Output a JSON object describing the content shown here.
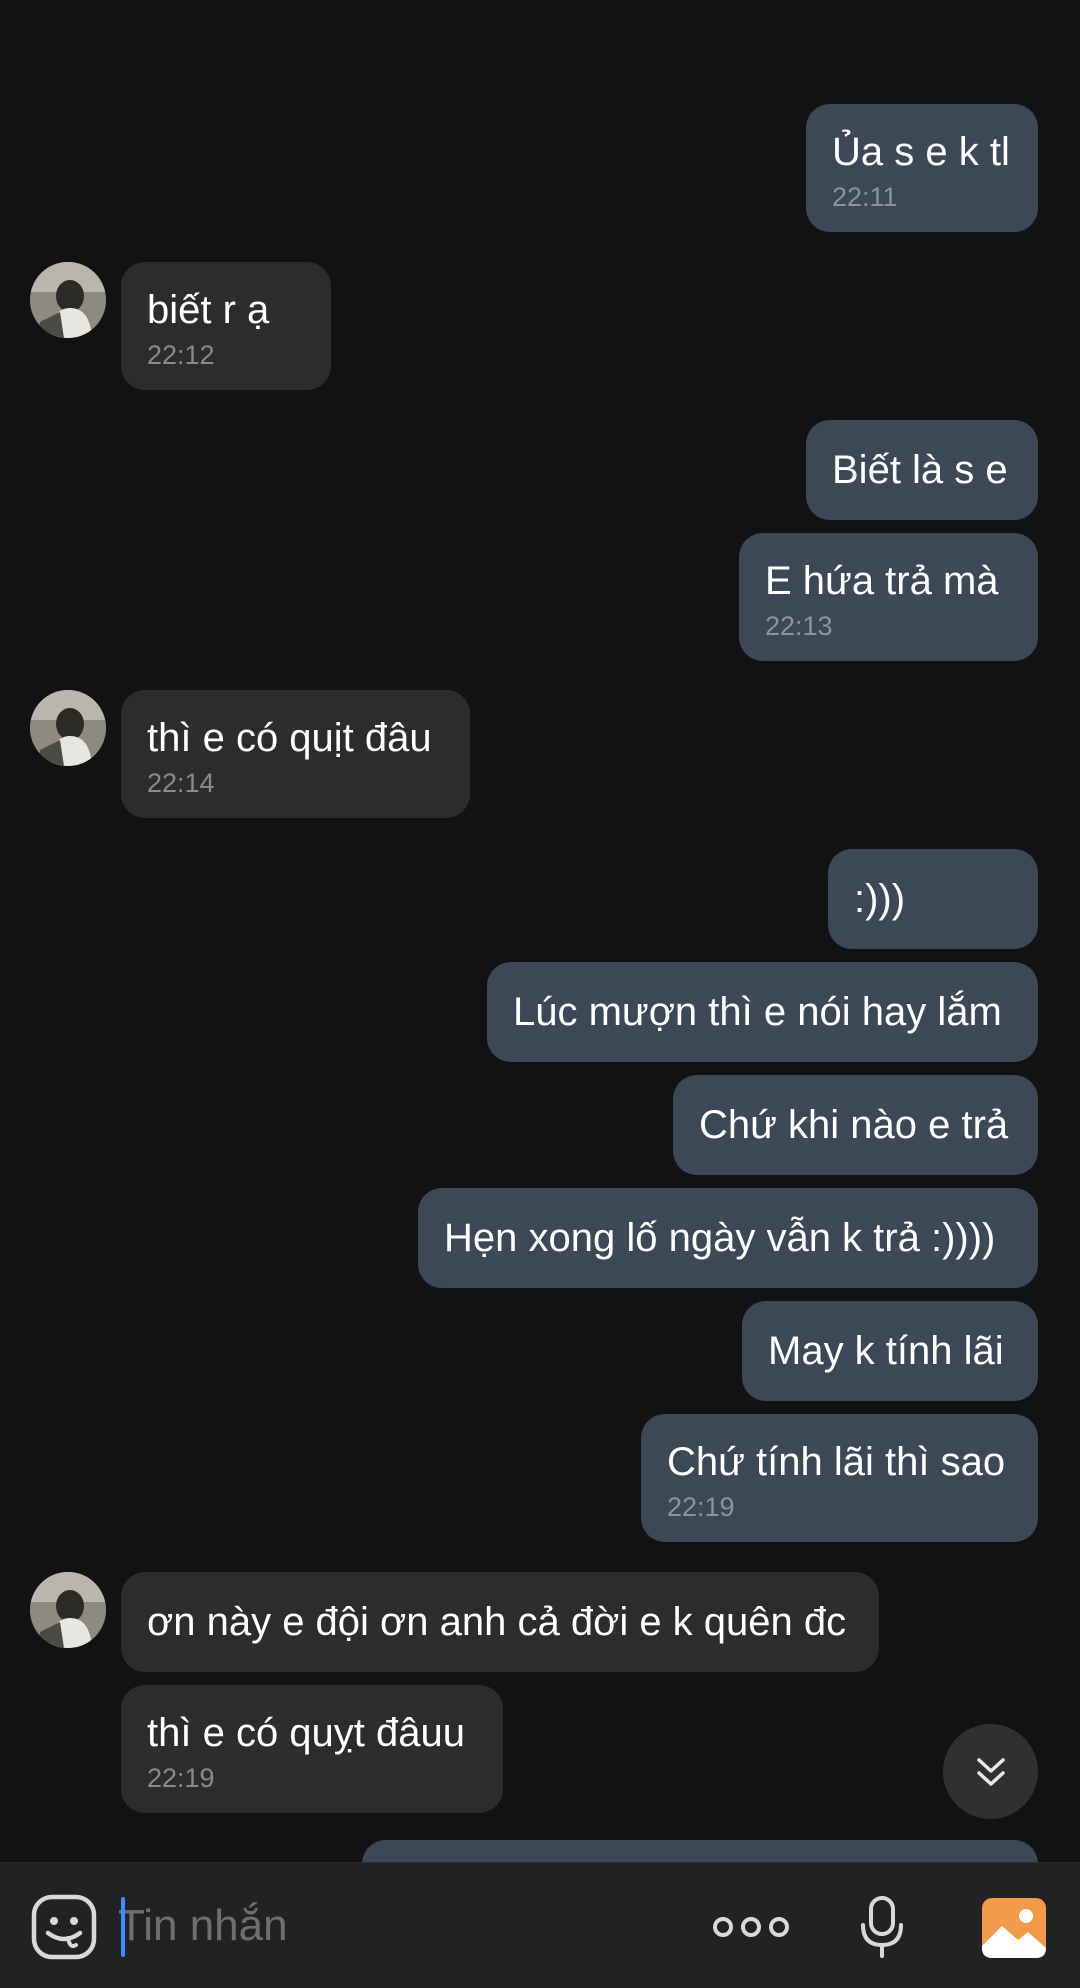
{
  "messages": [
    {
      "side": "me",
      "text": "Ủa s e k tl",
      "time": "22:11"
    },
    {
      "side": "them",
      "text": "biết r ạ",
      "time": "22:12"
    },
    {
      "side": "me",
      "text": "Biết là s e"
    },
    {
      "side": "me",
      "text": "E hứa trả mà",
      "time": "22:13"
    },
    {
      "side": "them",
      "text": "thì e có quịt đâu",
      "time": "22:14"
    },
    {
      "side": "me",
      "text": ":)))"
    },
    {
      "side": "me",
      "text": "Lúc mượn thì e nói hay lắm"
    },
    {
      "side": "me",
      "text": "Chứ khi nào e trả"
    },
    {
      "side": "me",
      "text": "Hẹn xong lố ngày vẫn k trả :))))"
    },
    {
      "side": "me",
      "text": "May k tính lãi"
    },
    {
      "side": "me",
      "text": "Chứ tính lãi thì sao",
      "time": "22:19"
    },
    {
      "side": "them",
      "text": "ơn này e đội ơn anh cả đời e k quên đc"
    },
    {
      "side": "them",
      "text": "thì e có quỵt đâuu",
      "time": "22:19"
    }
  ],
  "composer": {
    "placeholder": "Tin nhắn",
    "icons": [
      "emoji-icon",
      "more-icon",
      "microphone-icon",
      "gallery-icon"
    ]
  },
  "colors": {
    "background": "#121212",
    "outgoing_bubble": "#3d4857",
    "incoming_bubble": "#2c2c2e",
    "accent_caret": "#3f8cff",
    "gallery_icon": "#f2994a"
  }
}
